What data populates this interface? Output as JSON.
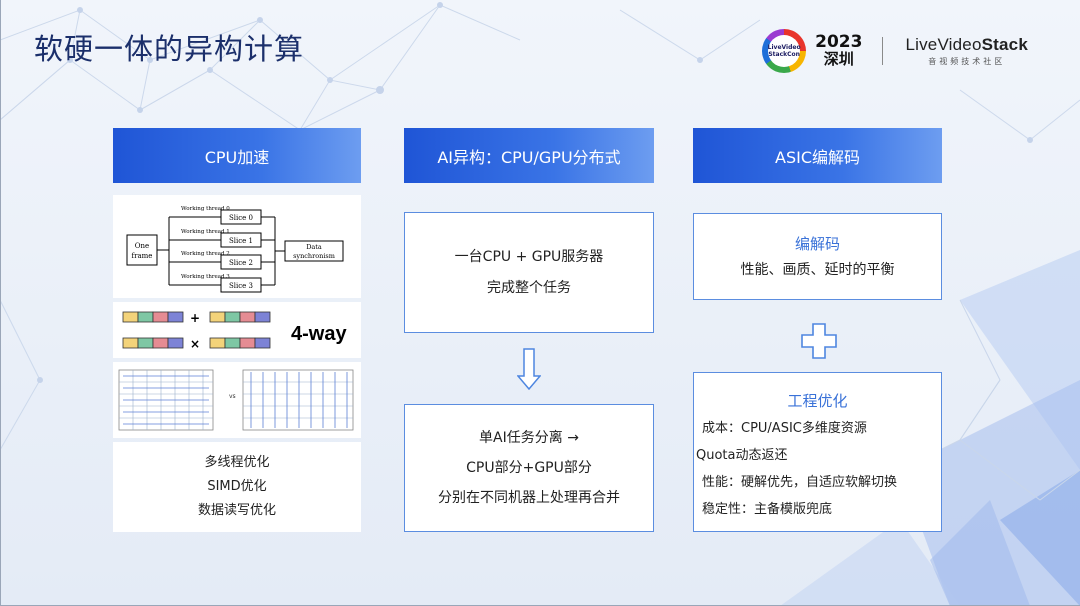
{
  "slide": {
    "title": "软硬一体的异构计算"
  },
  "logo": {
    "badge_text_1": "LiveVideo",
    "badge_text_2": "StackCon",
    "year": "2023",
    "city": "深圳",
    "brand_light": "LiveVideo",
    "brand_bold": "Stack",
    "brand_sub": "音视频技术社区"
  },
  "columns": [
    {
      "header": "CPU加速"
    },
    {
      "header": "AI异构：CPU/GPU分布式"
    },
    {
      "header": "ASIC编解码"
    }
  ],
  "cpu": {
    "diagram": {
      "input_label_1": "One",
      "input_label_2": "frame",
      "threads": [
        "Working thread 0",
        "Working thread 1",
        "Working thread 2",
        "Working thread 3"
      ],
      "slices": [
        "Slice 0",
        "Slice 1",
        "Slice 2",
        "Slice 3"
      ],
      "sync_label_1": "Data",
      "sync_label_2": "synchronism"
    },
    "simd": {
      "plus": "+",
      "times": "×",
      "label": "4-way"
    },
    "memory": {
      "vs": "vs"
    },
    "items": [
      "多线程优化",
      "SIMD优化",
      "数据读写优化"
    ]
  },
  "ai": {
    "box1": [
      "一台CPU + GPU服务器",
      "完成整个任务"
    ],
    "box2": [
      "单AI任务分离 →",
      "CPU部分+GPU部分",
      "分别在不同机器上处理再合并"
    ]
  },
  "asic": {
    "box1_title": "编解码",
    "box1_text": "性能、画质、延时的平衡",
    "box2_title": "工程优化",
    "box2_lines": [
      "成本：CPU/ASIC多维度资源",
      "Quota动态返还",
      "性能：硬解优先，自适应软解切换",
      "稳定性：主备模版兜底"
    ]
  },
  "colors": {
    "header_gradient_start": "#1f55d6",
    "header_gradient_end": "#6d9df0",
    "box_border": "#5b8de0",
    "accent_text": "#3a72d8",
    "title": "#1b2f6b"
  },
  "icons": [
    "down-arrow-icon",
    "plus-icon"
  ]
}
